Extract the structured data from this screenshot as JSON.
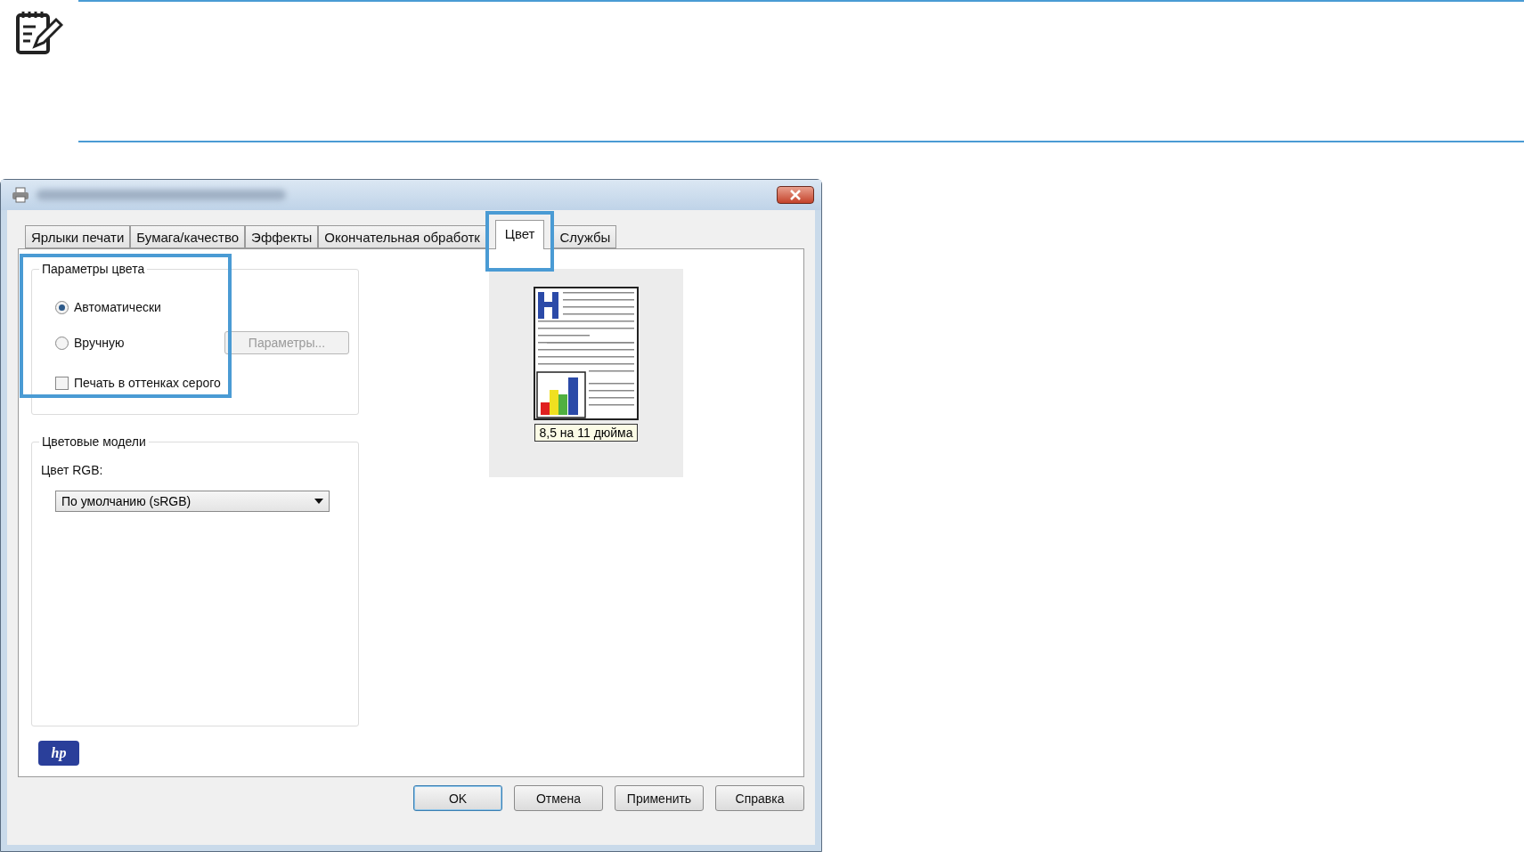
{
  "tabs": [
    {
      "label": "Ярлыки печати",
      "selected": false,
      "highlighted": false
    },
    {
      "label": "Бумага/качество",
      "selected": false,
      "highlighted": false
    },
    {
      "label": "Эффекты",
      "selected": false,
      "highlighted": false
    },
    {
      "label": "Окончательная обработк",
      "selected": false,
      "highlighted": false
    },
    {
      "label": "Цвет",
      "selected": true,
      "highlighted": true
    },
    {
      "label": "Службы",
      "selected": false,
      "highlighted": false
    }
  ],
  "color_options": {
    "title": "Параметры цвета",
    "highlighted": true,
    "options": [
      {
        "kind": "radio",
        "label": "Автоматически",
        "selected": true
      },
      {
        "kind": "radio",
        "label": "Вручную",
        "selected": false
      },
      {
        "kind": "checkbox",
        "label": "Печать в оттенках серого",
        "checked": false
      }
    ],
    "settings_button": {
      "label": "Параметры...",
      "disabled": true
    }
  },
  "color_models": {
    "title": "Цветовые модели",
    "rgb_label": "Цвет RGB:",
    "rgb_value": "По умолчанию (sRGB)"
  },
  "preview": {
    "paper_size": "8,5 на 11 дюйма"
  },
  "logo": "hp",
  "buttons": [
    {
      "label": "OK",
      "default": true
    },
    {
      "label": "Отмена",
      "default": false
    },
    {
      "label": "Применить",
      "default": false
    },
    {
      "label": "Справка",
      "default": false
    }
  ]
}
